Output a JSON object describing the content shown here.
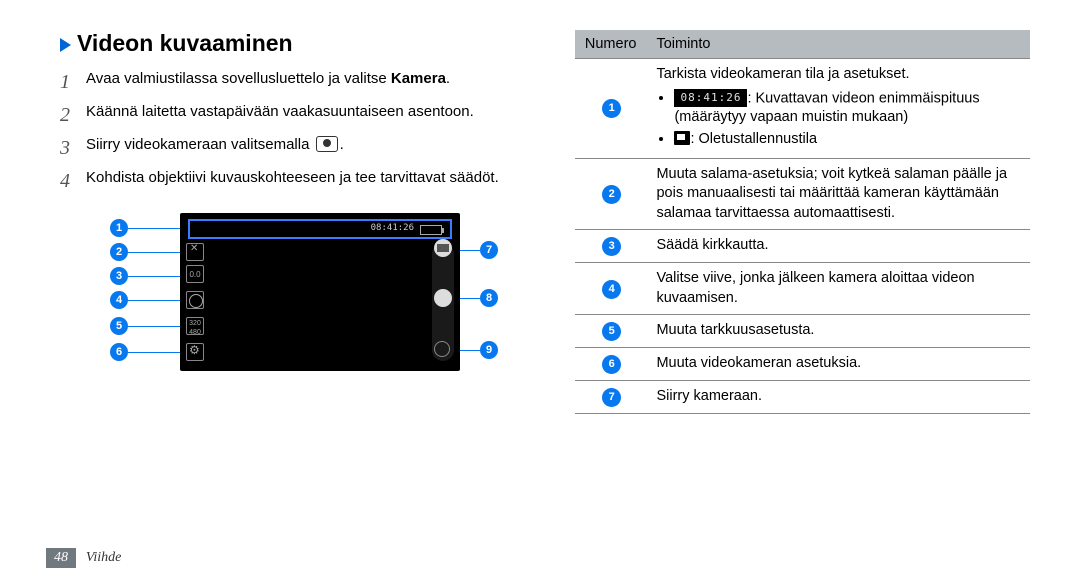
{
  "page": {
    "number": "48",
    "section": "Viihde"
  },
  "title": "Videon kuvaaminen",
  "steps": [
    {
      "num": "1",
      "text_prefix": "Avaa valmiustilassa sovellusluettelo ja valitse ",
      "bold": "Kamera",
      "text_suffix": "."
    },
    {
      "num": "2",
      "text": "Käännä laitetta vastapäivään vaakasuuntaiseen asentoon."
    },
    {
      "num": "3",
      "text_prefix": "Siirry videokameraan valitsemalla ",
      "has_icon": true,
      "text_suffix": "."
    },
    {
      "num": "4",
      "text": "Kohdista objektiivi kuvauskohteeseen ja tee tarvittavat säädöt."
    }
  ],
  "screen_time": "08:41:26",
  "side_ev": "0.0",
  "side_res": "320\n480",
  "table": {
    "head_num": "Numero",
    "head_func": "Toiminto",
    "rows": [
      {
        "badge": "1",
        "main": "Tarkista videokameran tila ja asetukset.",
        "bullets": [
          {
            "kind": "timecode",
            "code": "08:41:26",
            "after": ": Kuvattavan videon enimmäispituus (määräytyy vapaan muistin mukaan)"
          },
          {
            "kind": "storage",
            "after": ": Oletustallennustila"
          }
        ]
      },
      {
        "badge": "2",
        "main": "Muuta salama-asetuksia; voit kytkeä salaman päälle ja pois manuaalisesti tai määrittää kameran käyttämään salamaa tarvittaessa automaattisesti."
      },
      {
        "badge": "3",
        "main": "Säädä kirkkautta."
      },
      {
        "badge": "4",
        "main": "Valitse viive, jonka jälkeen kamera aloittaa videon kuvaamisen."
      },
      {
        "badge": "5",
        "main": "Muuta tarkkuusasetusta."
      },
      {
        "badge": "6",
        "main": "Muuta videokameran asetuksia."
      },
      {
        "badge": "7",
        "main": "Siirry kameraan."
      }
    ]
  }
}
